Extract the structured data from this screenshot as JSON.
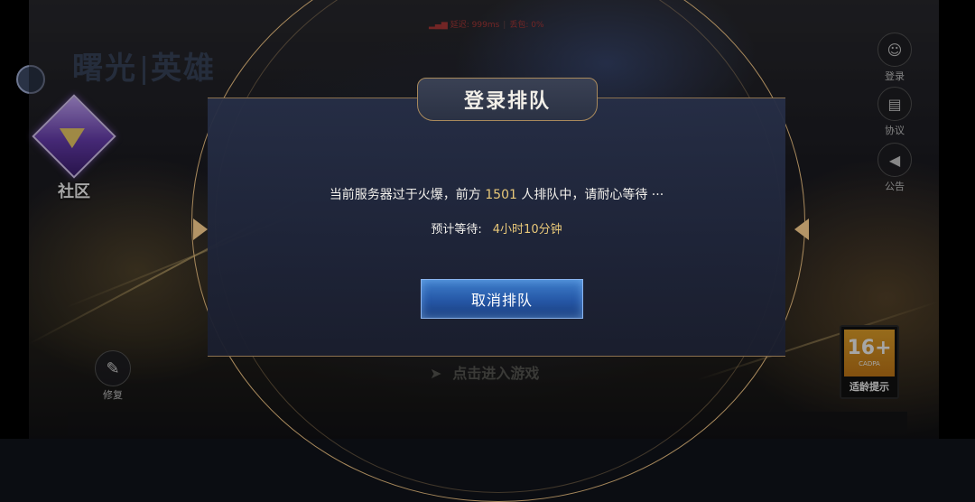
{
  "status": {
    "latency": "延迟: 999ms",
    "packet_loss": "丢包: 0%",
    "signal_icon": "signal-icon"
  },
  "logo": {
    "part1": "曙光",
    "part2": "英雄"
  },
  "left": {
    "community_label": "社区",
    "repair_label": "修复"
  },
  "right": {
    "login_label": "登录",
    "agreement_label": "协议",
    "notice_label": "公告"
  },
  "age_badge": {
    "number": "16+",
    "caption": "适龄提示",
    "sub": "CADPA"
  },
  "enter_game": "点击进入游戏",
  "dialog": {
    "title": "登录排队",
    "message_prefix": "当前服务器过于火爆，前方",
    "queue_count": "1501",
    "message_suffix": "人排队中，请耐心等待 ···",
    "wait_label": "预计等待:",
    "wait_value": "4小时10分钟",
    "cancel_label": "取消排队"
  },
  "colors": {
    "accent_gold": "#e8c879",
    "button_blue": "#2557a6",
    "frame_gold": "#a8895c"
  }
}
